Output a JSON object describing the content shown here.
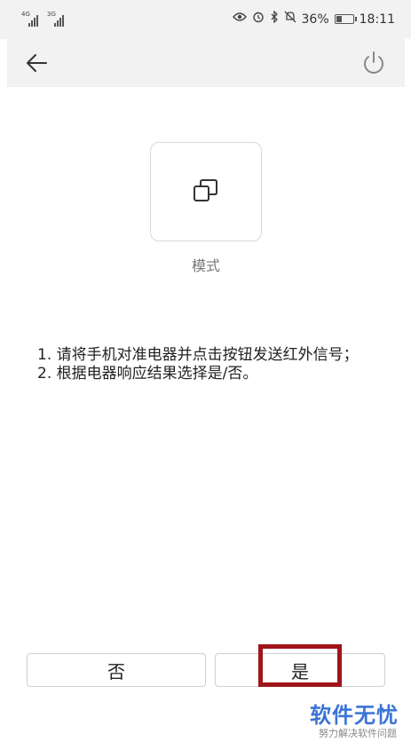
{
  "status_bar": {
    "signal1_label": "4G",
    "signal2_label": "3G",
    "battery_percent": "36%",
    "battery_level": 0.36,
    "time": "18:11",
    "icons": [
      "eye-icon",
      "alarm-icon",
      "bluetooth-icon",
      "mute-bell-icon"
    ]
  },
  "toolbar": {
    "back_icon": "arrow-left-icon",
    "power_icon": "power-icon"
  },
  "mode": {
    "icon": "copy-squares-icon",
    "label": "模式"
  },
  "instructions": {
    "line1": "1. 请将手机对准电器并点击按钮发送红外信号；",
    "line2": "2. 根据电器响应结果选择是/否。"
  },
  "buttons": {
    "no": "否",
    "yes": "是"
  },
  "watermark": {
    "title": "软件无忧",
    "subtitle": "努力解决软件问题"
  },
  "colors": {
    "highlight": "#a0151b",
    "watermark": "#3b74d6",
    "bar_bg": "#f2f2f2"
  }
}
